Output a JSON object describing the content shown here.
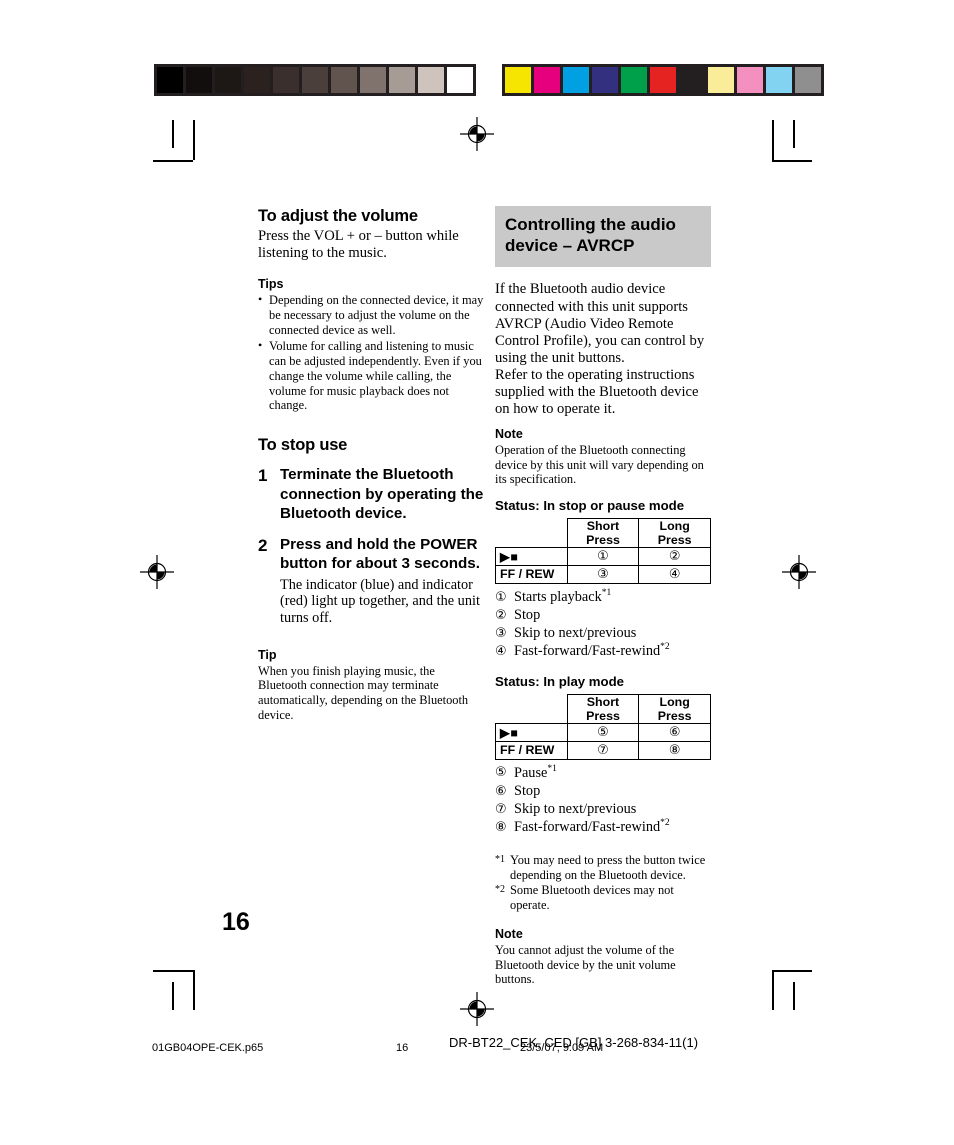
{
  "page": {
    "folio": "16"
  },
  "calibration": {
    "gray_swatches": [
      "#000000",
      "#120e0e",
      "#1d1715",
      "#2b2220",
      "#3a2f2c",
      "#4b3f3b",
      "#61544f",
      "#80736e",
      "#a79b96",
      "#cfc3be",
      "#ffffff"
    ],
    "color_swatches": [
      "#f6e500",
      "#e6007e",
      "#00a0e2",
      "#33317f",
      "#00a04b",
      "#e52320",
      "#231f20",
      "#faed9a",
      "#f490c0",
      "#82d3f2",
      "#8f8f8f"
    ]
  },
  "left_column": {
    "volume_heading": "To adjust the volume",
    "volume_body": "Press the VOL + or – button while listening to the music.",
    "tips_heading": "Tips",
    "tips": [
      "Depending on the connected device, it may be necessary to adjust the volume on the connected device as well.",
      "Volume for calling and listening to music can be adjusted independently. Even if you change the volume while calling, the volume for music playback does not change."
    ],
    "stop_heading": "To stop use",
    "steps": [
      {
        "number": "1",
        "text": "Terminate the Bluetooth connection by operating the Bluetooth device.",
        "body": ""
      },
      {
        "number": "2",
        "text": "Press and hold the POWER button for about 3 seconds.",
        "body": "The indicator (blue) and indicator (red) light up together, and the unit turns off."
      }
    ],
    "tip_heading": "Tip",
    "tip_body": "When you finish playing music, the Bluetooth connection may terminate automatically, depending on the Bluetooth device."
  },
  "right_column": {
    "title_line1": "Controlling the audio",
    "title_line2": "device – AVRCP",
    "intro": "If the Bluetooth audio device connected with this unit supports AVRCP (Audio Video Remote Control Profile), you can control by using the unit buttons.",
    "intro2": "Refer to the operating instructions supplied with the Bluetooth device on how to operate it.",
    "note1_heading": "Note",
    "note1_body": "Operation of the Bluetooth connecting device by this unit will vary depending on its specification.",
    "table1": {
      "status_label": "Status: In stop or pause mode",
      "columns": [
        "",
        "Short Press",
        "Long Press"
      ],
      "rows": [
        {
          "button": "▶■",
          "short": "①",
          "long": "②"
        },
        {
          "button": "FF / REW",
          "short": "③",
          "long": "④"
        }
      ],
      "legend": [
        {
          "mark": "①",
          "text": "Starts playback",
          "footnote": "*1"
        },
        {
          "mark": "②",
          "text": "Stop",
          "footnote": ""
        },
        {
          "mark": "③",
          "text": "Skip to next/previous",
          "footnote": ""
        },
        {
          "mark": "④",
          "text": "Fast-forward/Fast-rewind",
          "footnote": "*2"
        }
      ]
    },
    "table2": {
      "status_label": "Status: In play mode",
      "columns": [
        "",
        "Short Press",
        "Long Press"
      ],
      "rows": [
        {
          "button": "▶■",
          "short": "⑤",
          "long": "⑥"
        },
        {
          "button": "FF / REW",
          "short": "⑦",
          "long": "⑧"
        }
      ],
      "legend": [
        {
          "mark": "⑤",
          "text": "Pause",
          "footnote": "*1"
        },
        {
          "mark": "⑥",
          "text": "Stop",
          "footnote": ""
        },
        {
          "mark": "⑦",
          "text": "Skip to next/previous",
          "footnote": ""
        },
        {
          "mark": "⑧",
          "text": "Fast-forward/Fast-rewind",
          "footnote": "*2"
        }
      ]
    },
    "footnotes": [
      {
        "mark": "*1",
        "text": "You may need to press the button twice depending on the Bluetooth device."
      },
      {
        "mark": "*2",
        "text": "Some Bluetooth devices may not operate."
      }
    ],
    "note2_heading": "Note",
    "note2_body": "You cannot adjust the volume of the Bluetooth device by the unit volume buttons."
  },
  "footer": {
    "filename": "01GB04OPE-CEK.p65",
    "page_number": "16",
    "doc_id": "DR-BT22_CEK, CED [GB] 3-268-834-11(1)",
    "timestamp": "23/5/07, 9:09 AM"
  }
}
